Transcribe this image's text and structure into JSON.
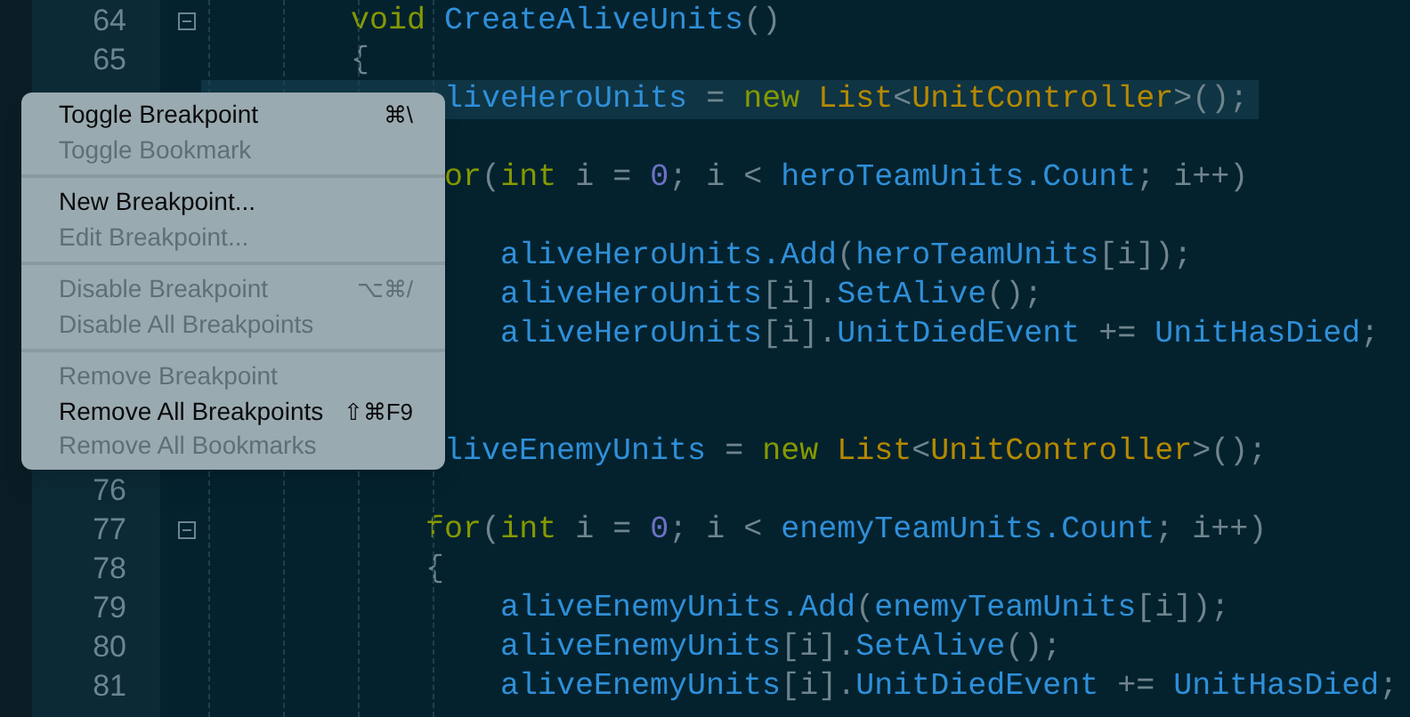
{
  "editor": {
    "lines": [
      {
        "number": "64",
        "fold": true,
        "current": false,
        "tokens": [
          {
            "kind": "keyword",
            "text": "        void "
          },
          {
            "kind": "ident",
            "text": "CreateAliveUnits"
          },
          {
            "kind": "plain",
            "text": "()"
          }
        ]
      },
      {
        "number": "65",
        "fold": false,
        "current": false,
        "tokens": [
          {
            "kind": "plain",
            "text": "        {"
          }
        ]
      },
      {
        "current": true,
        "tokens": [
          {
            "kind": "ident",
            "text": "             liveHeroUnits"
          },
          {
            "kind": "plain",
            "text": " = "
          },
          {
            "kind": "keyword",
            "text": "new "
          },
          {
            "kind": "type",
            "text": "List"
          },
          {
            "kind": "plain",
            "text": "<"
          },
          {
            "kind": "type",
            "text": "UnitController"
          },
          {
            "kind": "plain",
            "text": ">();"
          }
        ]
      },
      {
        "current": false
      },
      {
        "current": false,
        "tokens": [
          {
            "kind": "keyword",
            "text": "             or"
          },
          {
            "kind": "plain",
            "text": "("
          },
          {
            "kind": "keyword",
            "text": "int"
          },
          {
            "kind": "plain",
            "text": " i = "
          },
          {
            "kind": "number",
            "text": "0"
          },
          {
            "kind": "plain",
            "text": "; i < "
          },
          {
            "kind": "ident",
            "text": "heroTeamUnits.Count"
          },
          {
            "kind": "plain",
            "text": "; i++)"
          }
        ]
      },
      {
        "current": false
      },
      {
        "current": false,
        "tokens": [
          {
            "kind": "ident",
            "text": "                aliveHeroUnits.Add"
          },
          {
            "kind": "plain",
            "text": "("
          },
          {
            "kind": "ident",
            "text": "heroTeamUnits"
          },
          {
            "kind": "plain",
            "text": "[i]);"
          }
        ]
      },
      {
        "current": false,
        "tokens": [
          {
            "kind": "ident",
            "text": "                aliveHeroUnits"
          },
          {
            "kind": "plain",
            "text": "[i]."
          },
          {
            "kind": "ident",
            "text": "SetAlive"
          },
          {
            "kind": "plain",
            "text": "();"
          }
        ]
      },
      {
        "current": false,
        "tokens": [
          {
            "kind": "ident",
            "text": "                aliveHeroUnits"
          },
          {
            "kind": "plain",
            "text": "[i]."
          },
          {
            "kind": "ident",
            "text": "UnitDiedEvent"
          },
          {
            "kind": "plain",
            "text": " += "
          },
          {
            "kind": "ident",
            "text": "UnitHasDied"
          },
          {
            "kind": "plain",
            "text": ";"
          }
        ]
      },
      {
        "current": false
      },
      {
        "current": false
      },
      {
        "current": false,
        "tokens": [
          {
            "kind": "ident",
            "text": "             liveEnemyUnits"
          },
          {
            "kind": "plain",
            "text": " = "
          },
          {
            "kind": "keyword",
            "text": "new "
          },
          {
            "kind": "type",
            "text": "List"
          },
          {
            "kind": "plain",
            "text": "<"
          },
          {
            "kind": "type",
            "text": "UnitController"
          },
          {
            "kind": "plain",
            "text": ">();"
          }
        ]
      },
      {
        "number": "76",
        "fold": false,
        "current": false
      },
      {
        "number": "77",
        "fold": true,
        "current": false,
        "tokens": [
          {
            "kind": "keyword",
            "text": "            for"
          },
          {
            "kind": "plain",
            "text": "("
          },
          {
            "kind": "keyword",
            "text": "int"
          },
          {
            "kind": "plain",
            "text": " i = "
          },
          {
            "kind": "number",
            "text": "0"
          },
          {
            "kind": "plain",
            "text": "; i < "
          },
          {
            "kind": "ident",
            "text": "enemyTeamUnits.Count"
          },
          {
            "kind": "plain",
            "text": "; i++)"
          }
        ]
      },
      {
        "number": "78",
        "fold": false,
        "current": false,
        "tokens": [
          {
            "kind": "plain",
            "text": "            {"
          }
        ]
      },
      {
        "number": "79",
        "fold": false,
        "current": false,
        "tokens": [
          {
            "kind": "ident",
            "text": "                aliveEnemyUnits.Add"
          },
          {
            "kind": "plain",
            "text": "("
          },
          {
            "kind": "ident",
            "text": "enemyTeamUnits"
          },
          {
            "kind": "plain",
            "text": "[i]);"
          }
        ]
      },
      {
        "number": "80",
        "fold": false,
        "current": false,
        "tokens": [
          {
            "kind": "ident",
            "text": "                aliveEnemyUnits"
          },
          {
            "kind": "plain",
            "text": "[i]."
          },
          {
            "kind": "ident",
            "text": "SetAlive"
          },
          {
            "kind": "plain",
            "text": "();"
          }
        ]
      },
      {
        "number": "81",
        "fold": false,
        "current": false,
        "tokens": [
          {
            "kind": "ident",
            "text": "                aliveEnemyUnits"
          },
          {
            "kind": "plain",
            "text": "[i]."
          },
          {
            "kind": "ident",
            "text": "UnitDiedEvent"
          },
          {
            "kind": "plain",
            "text": " += "
          },
          {
            "kind": "ident",
            "text": "UnitHasDied"
          },
          {
            "kind": "plain",
            "text": ";"
          }
        ]
      }
    ]
  },
  "context_menu": {
    "groups": [
      [
        {
          "label": "Toggle Breakpoint",
          "shortcut": "⌘\\",
          "disabled": false
        },
        {
          "label": "Toggle Bookmark",
          "disabled": true
        }
      ],
      [
        {
          "label": "New Breakpoint...",
          "disabled": false
        },
        {
          "label": "Edit Breakpoint...",
          "disabled": true
        }
      ],
      [
        {
          "label": "Disable Breakpoint",
          "shortcut": "⌥⌘/",
          "disabled": true
        },
        {
          "label": "Disable All Breakpoints",
          "disabled": true
        }
      ],
      [
        {
          "label": "Remove Breakpoint",
          "disabled": true
        },
        {
          "label": "Remove All Breakpoints",
          "shortcut": "⇧⌘F9",
          "disabled": false
        },
        {
          "label": "Remove All Bookmarks",
          "disabled": true
        }
      ]
    ]
  }
}
